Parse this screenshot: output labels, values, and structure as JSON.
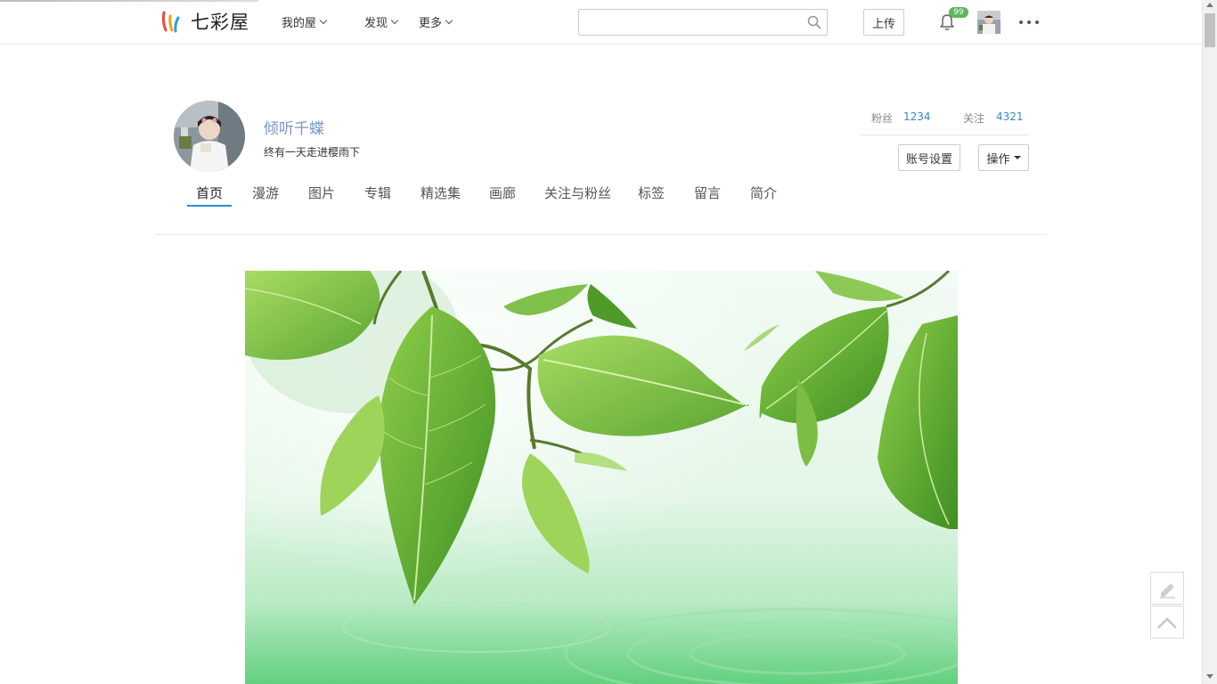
{
  "header": {
    "logo_text": "七彩屋",
    "nav": [
      {
        "label": "我的屋"
      },
      {
        "label": "发现"
      },
      {
        "label": "更多"
      }
    ],
    "search": {
      "placeholder": "",
      "value": ""
    },
    "upload_label": "上传",
    "notification_count": "99"
  },
  "profile": {
    "name": "倾听千蝶",
    "signature": "终有一天走进樱雨下",
    "fans_label": "粉丝",
    "fans_count": "1234",
    "follow_label": "关注",
    "follow_count": "4321",
    "account_settings_label": "账号设置",
    "operations_label": "操作"
  },
  "tabs": [
    {
      "label": "首页",
      "active": true
    },
    {
      "label": "漫游"
    },
    {
      "label": "图片"
    },
    {
      "label": "专辑"
    },
    {
      "label": "精选集"
    },
    {
      "label": "画廊"
    },
    {
      "label": "关注与粉丝"
    },
    {
      "label": "标签"
    },
    {
      "label": "留言"
    },
    {
      "label": "简介"
    }
  ],
  "colors": {
    "accent": "#2b8cd6",
    "link": "#3a87c8",
    "username": "#7a97c2",
    "badge": "#5cb85c"
  },
  "icons": [
    "search-icon",
    "bell-icon",
    "more-dots-icon",
    "edit-icon",
    "back-to-top-icon"
  ]
}
